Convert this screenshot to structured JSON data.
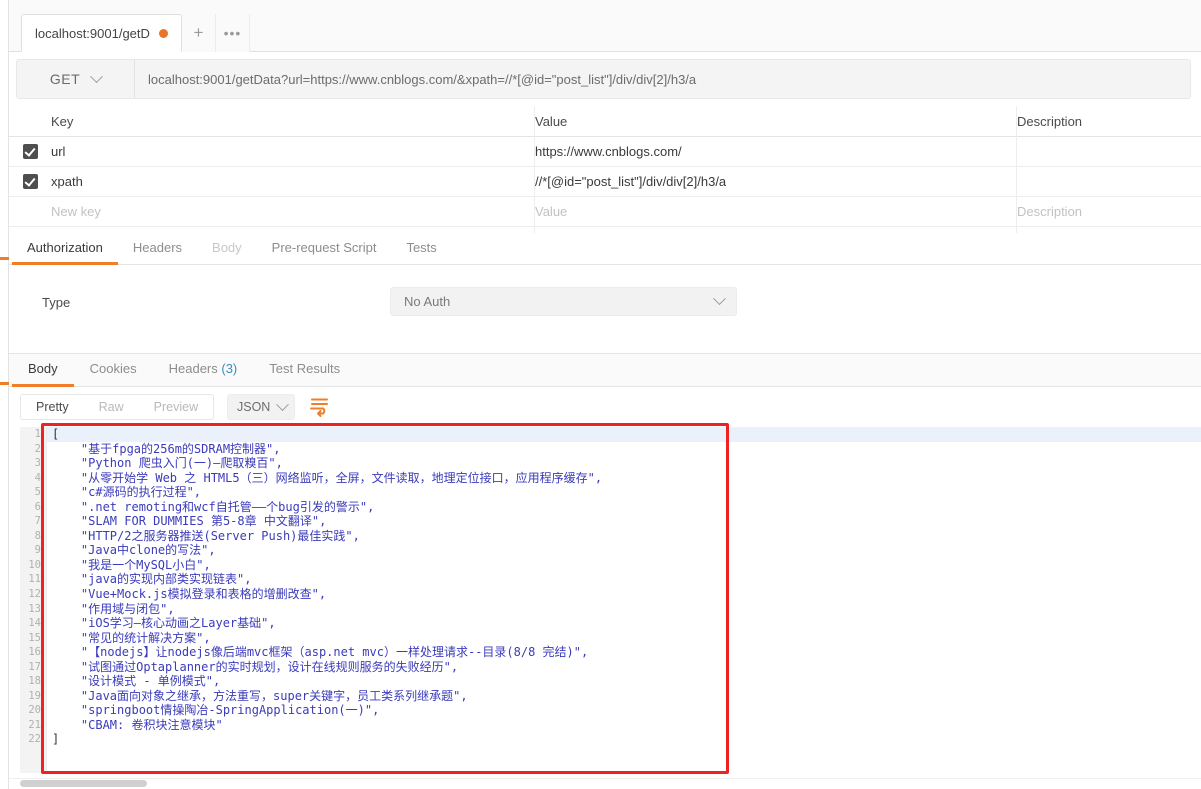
{
  "app": {
    "name": "postman-api-client"
  },
  "theme": {
    "accent": "#f07d28",
    "link": "#3c8dbc",
    "json_string": "#3b3bbb",
    "annotation": "#ee2222"
  },
  "tabbar": {
    "request_tab_label": "localhost:9001/getD",
    "unsaved_indicator": "unsaved-dot",
    "new_tab_label": "+",
    "more_label": "•••"
  },
  "urlbar": {
    "method": "GET",
    "url": "localhost:9001/getData?url=https://www.cnblogs.com/&xpath=//*[@id=\"post_list\"]/div/div[2]/h3/a"
  },
  "params": {
    "columns": [
      "Key",
      "Value",
      "Description"
    ],
    "rows": [
      {
        "checked": true,
        "key": "url",
        "value": "https://www.cnblogs.com/",
        "description": ""
      },
      {
        "checked": true,
        "key": "xpath",
        "value": "//*[@id=\"post_list\"]/div/div[2]/h3/a",
        "description": ""
      }
    ],
    "placeholder_row": {
      "key": "New key",
      "value": "Value",
      "description": "Description"
    }
  },
  "request_tabs": [
    {
      "label": "Authorization",
      "state": "active"
    },
    {
      "label": "Headers",
      "state": "normal"
    },
    {
      "label": "Body",
      "state": "dim"
    },
    {
      "label": "Pre-request Script",
      "state": "normal"
    },
    {
      "label": "Tests",
      "state": "normal"
    }
  ],
  "auth": {
    "type_label": "Type",
    "selected": "No Auth"
  },
  "response_tabs": [
    {
      "label": "Body",
      "state": "active",
      "count": ""
    },
    {
      "label": "Cookies",
      "state": "normal",
      "count": ""
    },
    {
      "label": "Headers",
      "state": "normal",
      "count": "(3)"
    },
    {
      "label": "Test Results",
      "state": "normal",
      "count": ""
    }
  ],
  "response_toolbar": {
    "view_modes": [
      {
        "label": "Pretty",
        "active": true
      },
      {
        "label": "Raw",
        "active": false
      },
      {
        "label": "Preview",
        "active": false
      }
    ],
    "format": "JSON",
    "wrap_icon": "wrap-lines-icon"
  },
  "response_body": {
    "line_numbers": [
      "1",
      "2",
      "3",
      "4",
      "5",
      "6",
      "7",
      "8",
      "9",
      "10",
      "11",
      "12",
      "13",
      "14",
      "15",
      "16",
      "17",
      "18",
      "19",
      "20",
      "21",
      "22"
    ],
    "lines": [
      "[",
      "    \"基于fpga的256m的SDRAM控制器\",",
      "    \"Python 爬虫入门(一)—爬取糗百\",",
      "    \"从零开始学 Web 之 HTML5（三）网络监听，全屏，文件读取，地理定位接口，应用程序缓存\",",
      "    \"c#源码的执行过程\",",
      "    \".net remoting和wcf自托管——个bug引发的警示\",",
      "    \"SLAM FOR DUMMIES 第5-8章 中文翻译\",",
      "    \"HTTP/2之服务器推送(Server Push)最佳实践\",",
      "    \"Java中clone的写法\",",
      "    \"我是一个MySQL小白\",",
      "    \"java的实现内部类实现链表\",",
      "    \"Vue+Mock.js模拟登录和表格的增删改查\",",
      "    \"作用域与闭包\",",
      "    \"iOS学习—核心动画之Layer基础\",",
      "    \"常见的统计解决方案\",",
      "    \"【nodejs】让nodejs像后端mvc框架（asp.net mvc）一样处理请求--目录(8/8 完结)\",",
      "    \"试图通过Optaplanner的实时规划，设计在线规则服务的失败经历\",",
      "    \"设计模式 - 单例模式\",",
      "    \"Java面向对象之继承，方法重写，super关键字，员工类系列继承题\",",
      "    \"springboot情操陶冶-SpringApplication(一)\",",
      "    \"CBAM: 卷积块注意模块\"",
      "]"
    ]
  },
  "annotation": {
    "name": "red-highlight-box"
  }
}
